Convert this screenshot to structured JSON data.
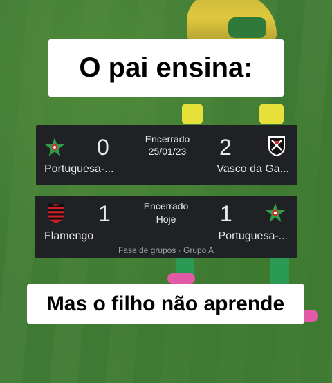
{
  "captions": {
    "top": "O pai ensina:",
    "bottom": "Mas o filho não aprende"
  },
  "match1": {
    "home_team": "Portuguesa-...",
    "home_logo": "portuguesa-star-icon",
    "home_score": "0",
    "away_team": "Vasco da Ga...",
    "away_logo": "vasco-crest-icon",
    "away_score": "2",
    "status": "Encerrado",
    "date": "25/01/23"
  },
  "match2": {
    "home_team": "Flamengo",
    "home_logo": "flamengo-crest-icon",
    "home_score": "1",
    "away_team": "Portuguesa-...",
    "away_logo": "portuguesa-star-icon",
    "away_score": "1",
    "status": "Encerrado",
    "date": "Hoje",
    "stage": "Fase de grupos · Grupo A"
  },
  "colors": {
    "card_bg": "#202124",
    "card_text": "#e8eaed",
    "muted_text": "#9aa0a6",
    "caption_bg": "#ffffff",
    "portuguesa_green": "#2e9e4a",
    "portuguesa_red": "#d62b2b",
    "flamengo_red": "#d11f26",
    "flamengo_black": "#111111"
  }
}
